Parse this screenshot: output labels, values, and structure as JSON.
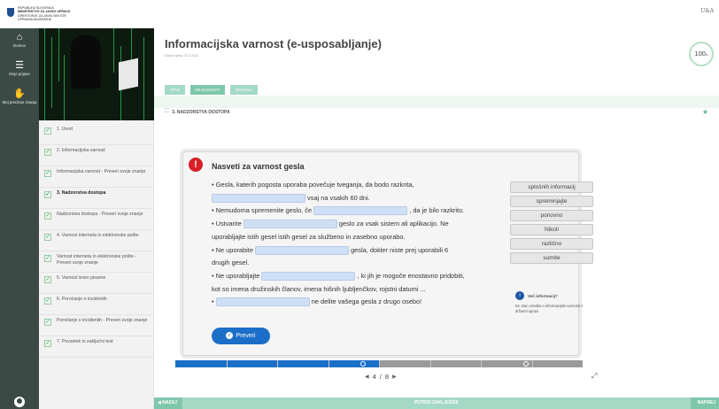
{
  "header": {
    "logo_lines": [
      "Republika Slovenija",
      "Ministrstvo za javno upravo",
      "Direktorat za javni sektor",
      "Upravna akademija"
    ],
    "partner_logo": "U&A"
  },
  "vnav": {
    "items": [
      {
        "label": "Domov",
        "icon": "home-icon"
      },
      {
        "label": "Moje prijave",
        "icon": "list-icon"
      },
      {
        "label": "Moj preizkus znanja",
        "icon": "hand-icon"
      }
    ]
  },
  "toc": {
    "items": [
      {
        "label": "1. Uvod",
        "done": true,
        "active": false
      },
      {
        "label": "2. Informacijska varnost",
        "done": true,
        "active": false
      },
      {
        "label": "Informacijska varnost - Preveri svoje znanje",
        "done": true,
        "active": false
      },
      {
        "label": "3. Nadzorstva dostopa",
        "done": true,
        "active": true
      },
      {
        "label": "Nadzorstva dostopa - Preveri svoje znanje",
        "done": true,
        "active": false
      },
      {
        "label": "4. Varnost interneta in elektronske pošte",
        "done": true,
        "active": false
      },
      {
        "label": "Varnost interneta in elektronske pošte - Preveri svoje znanje",
        "done": true,
        "active": false
      },
      {
        "label": "5. Varnost izven pisarne",
        "done": true,
        "active": false
      },
      {
        "label": "6. Poročanje o incidentih",
        "done": true,
        "active": false
      },
      {
        "label": "Poročanje o incidentih - Preveri svoje znanje",
        "done": true,
        "active": false
      },
      {
        "label": "7. Povzetek in zaključni test",
        "done": true,
        "active": false
      }
    ]
  },
  "main": {
    "title": "Informacijska varnost (e-usposabljanje)",
    "subtitle": "Datum vpisa: 22.3.2023",
    "progress": "100",
    "progress_unit": "%",
    "tabs": [
      "OPIS",
      "DEJAVNOSTI",
      "GRADIVA"
    ],
    "section": "3. NADZORSTVA DOSTOPA"
  },
  "card": {
    "title": "Nasveti za varnost gesla",
    "lines": [
      {
        "pre": "• Gesla, katerih pogosta uporaba povečuje tveganja, da bodo razkrita,",
        "blank": false,
        "post": ""
      },
      {
        "pre": "",
        "blank": true,
        "post": " vsaj na vsakih 60 dni."
      },
      {
        "pre": "• Nemudoma spremenite geslo, če ",
        "blank": true,
        "post": " , da je bilo razkrito."
      },
      {
        "pre": "• Ustvarite ",
        "blank": true,
        "post": " geslo za vsak sistem ali aplikacijo. Ne"
      },
      {
        "pre": "uporabljajte istih gesel istih gesel za službeno in zasebno uporabo.",
        "blank": false,
        "post": ""
      },
      {
        "pre": "• Ne uporabite ",
        "blank": true,
        "post": " gesla, dokler niste prej uporabili 6"
      },
      {
        "pre": "drugih gesel.",
        "blank": false,
        "post": ""
      },
      {
        "pre": "• Ne uporabljajte ",
        "blank": true,
        "post": " , ki jih je mogoče enostavno pridobiti,"
      },
      {
        "pre": "kot so imena družinskih članov, imena hišnih ljubljenčkov, rojstni datumi ...",
        "blank": false,
        "post": ""
      },
      {
        "pre": "• ",
        "blank": true,
        "post": " ne delite vašega gesla z drugo osebo!"
      }
    ],
    "words": [
      "splošnih informacij",
      "spreminjajte",
      "ponovno",
      "Nikoli",
      "različno",
      "sumite"
    ],
    "info_title": "Več informacij?",
    "info_text": "54. Dan Uradka o informacijski varnosti v državni upravi",
    "check_label": "Preveri"
  },
  "pager": {
    "current": "4",
    "separator": "/",
    "total": "8",
    "progress_fraction": 0.5
  },
  "footer": {
    "back": "NAZAJ",
    "confirm": "POTRDI ZAKLJUČEK",
    "next": "NAPREJ"
  },
  "colors": {
    "accent": "#1b6fc9",
    "tab_green": "#a4d9c5",
    "nav_dark": "#3c4a46",
    "warn_red": "#d81f26"
  }
}
